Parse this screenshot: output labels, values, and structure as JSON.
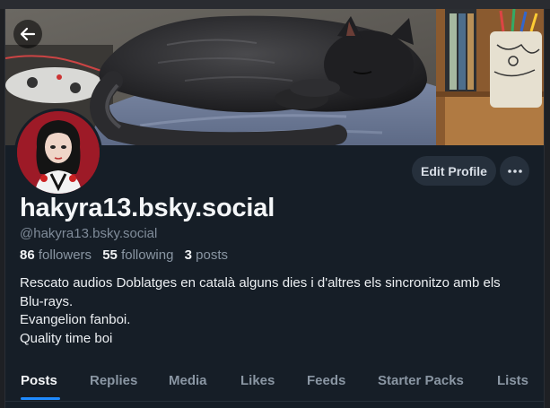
{
  "profile": {
    "display_name": "hakyra13.bsky.social",
    "handle": "@hakyra13.bsky.social",
    "stats": {
      "followers_count": "86",
      "followers_label": "followers",
      "following_count": "55",
      "following_label": "following",
      "posts_count": "3",
      "posts_label": "posts"
    },
    "bio_lines": [
      "Rescato audios Doblatges en català alguns dies i d'altres els sincronitzo amb els",
      "Blu-rays.",
      "Evangelion fanboi.",
      "Quality time boi"
    ]
  },
  "actions": {
    "edit_profile_label": "Edit Profile",
    "more_icon": "ellipsis-icon",
    "back_icon": "arrow-left-icon"
  },
  "tabs": [
    {
      "label": "Posts",
      "active": true
    },
    {
      "label": "Replies",
      "active": false
    },
    {
      "label": "Media",
      "active": false
    },
    {
      "label": "Likes",
      "active": false
    },
    {
      "label": "Feeds",
      "active": false
    },
    {
      "label": "Starter Packs",
      "active": false
    },
    {
      "label": "Lists",
      "active": false
    }
  ],
  "colors": {
    "background": "#161e27",
    "accent": "#1f8bff",
    "button_bg": "#26303c",
    "muted_text": "#8a96a3"
  }
}
